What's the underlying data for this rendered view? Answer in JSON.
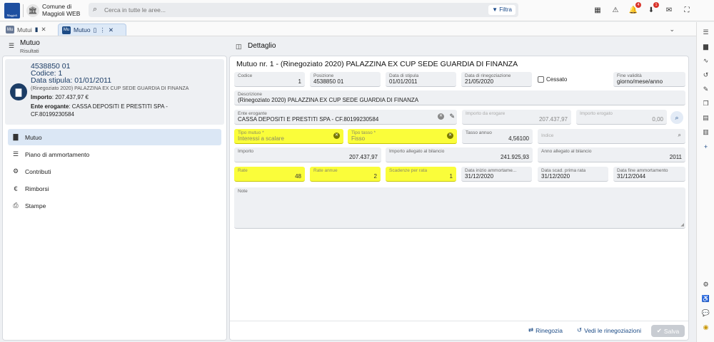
{
  "topbar": {
    "logo_text": "Maggioli",
    "org_name": "Comune di Maggioli WEB",
    "search_placeholder": "Cerca in tutte le aree...",
    "filter_label": "Filtra",
    "icons": [
      "grid-icon",
      "warning-icon",
      "bell-icon",
      "download-icon",
      "mail-icon",
      "fullscreen-icon"
    ],
    "bell_badge": "4",
    "download_badge": "1"
  },
  "tabs": {
    "tab1": {
      "label": "Mutui",
      "icon": "Mu"
    },
    "tab2": {
      "label": "Mutuo",
      "icon": "Mu"
    }
  },
  "left": {
    "header_title": "Mutuo",
    "header_sub": "Risultati",
    "summary": {
      "code": "4538850 01",
      "codice": "Codice: 1",
      "data_stipula": "Data stipula: 01/01/2011",
      "description": "(Rinegoziato 2020) PALAZZINA EX CUP SEDE GUARDIA DI FINANZA",
      "importo_label": "Importo",
      "importo_value": ": 207.437,97 €",
      "ente_label": "Ente erogante",
      "ente_value": ": CASSA DEPOSITI E PRESTITI SPA - CF.80199230584"
    },
    "menu": [
      {
        "label": "Mutuo",
        "icon": "document-icon",
        "glyph": "▇"
      },
      {
        "label": "Piano di ammortamento",
        "icon": "list-icon",
        "glyph": "☰"
      },
      {
        "label": "Contributi",
        "icon": "contributi-icon",
        "glyph": "⚙"
      },
      {
        "label": "Rimborsi",
        "icon": "euro-icon",
        "glyph": "€"
      },
      {
        "label": "Stampe",
        "icon": "printer-icon",
        "glyph": "⎙"
      }
    ]
  },
  "detail": {
    "header_title": "Dettaglio",
    "title": "Mutuo nr. 1 - (Rinegoziato 2020) PALAZZINA EX CUP SEDE GUARDIA DI FINANZA",
    "codice": {
      "label": "Codice",
      "value": "1"
    },
    "posizione": {
      "label": "Posizione",
      "value": "4538850 01"
    },
    "data_stipula": {
      "label": "Data di stipula",
      "value": "01/01/2011"
    },
    "data_rinegoziazione": {
      "label": "Data di rinegoziazione",
      "value": "21/05/2020"
    },
    "cessato": {
      "label": "Cessato"
    },
    "fine_validita": {
      "label": "Fine validità",
      "value": "giorno/mese/anno"
    },
    "descrizione": {
      "label": "Descrizione",
      "value": "(Rinegoziato 2020) PALAZZINA EX CUP SEDE GUARDIA DI FINANZA"
    },
    "ente_erogante": {
      "label": "Ente erogante",
      "value": "CASSA DEPOSITI E PRESTITI SPA - CF.80199230584"
    },
    "importo_da_erogare": {
      "label": "Importo da erogare",
      "value": "207.437,97"
    },
    "importo_erogato": {
      "label": "Importo erogato",
      "value": "0,00"
    },
    "tipo_mutuo": {
      "label": "Tipo mutuo *",
      "value": "Interessi a scalare"
    },
    "tipo_tasso": {
      "label": "Tipo tasso *",
      "value": "Fisso"
    },
    "tasso_annuo": {
      "label": "Tasso annuo",
      "value": "4,56100"
    },
    "indice": {
      "label": "Indice"
    },
    "importo": {
      "label": "Importo",
      "value": "207.437,97"
    },
    "importo_allegato": {
      "label": "Importo allegato al bilancio",
      "value": "241.925,93"
    },
    "anno_allegato": {
      "label": "Anno allegato al bilancio",
      "value": "2011"
    },
    "rate": {
      "label": "Rate",
      "value": "48"
    },
    "rate_annue": {
      "label": "Rate annue",
      "value": "2"
    },
    "scadenze": {
      "label": "Scadenze per rata",
      "value": "1"
    },
    "data_inizio": {
      "label": "Data inizio ammortame...",
      "value": "31/12/2020"
    },
    "data_scad": {
      "label": "Data scad. prima rata",
      "value": "31/12/2020"
    },
    "data_fine": {
      "label": "Data fine ammortamento",
      "value": "31/12/2044"
    },
    "note": {
      "label": "Note"
    },
    "footer": {
      "rinegozia": "Rinegozia",
      "vedi": "Vedi le rinegoziazioni",
      "salva": "Salva"
    }
  },
  "colors": {
    "highlight": "#fafd3a",
    "primary": "#1c4b86",
    "active_menu": "#dbe7f5"
  }
}
